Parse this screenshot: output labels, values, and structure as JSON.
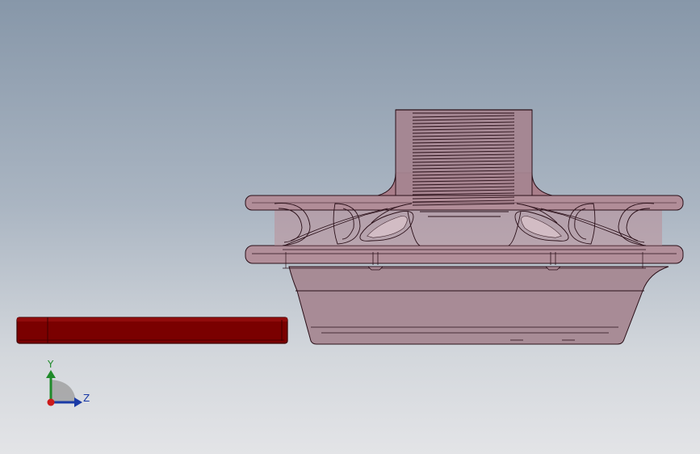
{
  "viewport": {
    "background_top": "#8797a9",
    "background_bottom": "#e3e4e7"
  },
  "model": {
    "body_color": "#a97e8a",
    "body_fill_opacity": 0.85,
    "edge_color": "#2a0f18",
    "bar_color": "#7a0000",
    "bar_edge": "#3d0000"
  },
  "triad": {
    "y_label": "Y",
    "z_label": "Z",
    "y_color": "#1f8a2a",
    "z_color": "#1a3aa6",
    "x_color": "#cc1a1a"
  }
}
